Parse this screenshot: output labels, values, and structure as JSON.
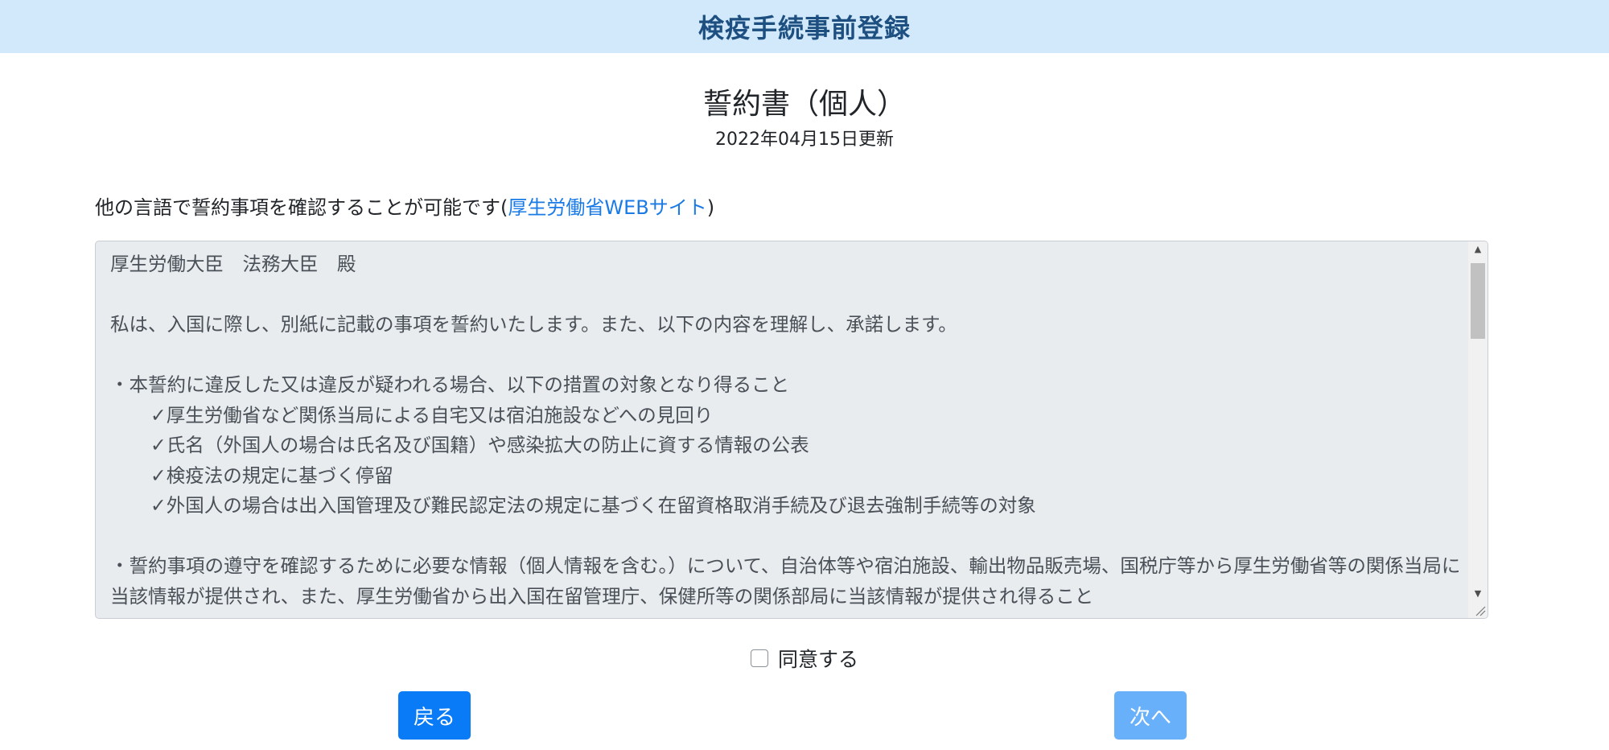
{
  "header": {
    "title": "検疫手続事前登録"
  },
  "document": {
    "title": "誓約書（個人）",
    "updated": "2022年04月15日更新"
  },
  "language_note": {
    "text": "他の言語で誓約事項を確認することが可能です(",
    "link": "厚生労働省WEBサイト",
    "suffix": ")"
  },
  "terms": {
    "addressee": "厚生労働大臣　法務大臣　殿",
    "intro": "私は、入国に際し、別紙に記載の事項を誓約いたします。また、以下の内容を理解し、承諾します。",
    "bullet1": "・本誓約に違反した又は違反が疑われる場合、以下の措置の対象となり得ること",
    "sub_items": [
      "✓厚生労働省など関係当局による自宅又は宿泊施設などへの見回り",
      "✓氏名（外国人の場合は氏名及び国籍）や感染拡大の防止に資する情報の公表",
      "✓検疫法の規定に基づく停留",
      "✓外国人の場合は出入国管理及び難民認定法の規定に基づく在留資格取消手続及び退去強制手続等の対象"
    ],
    "bullet2": "・誓約事項の遵守を確認するために必要な情報（個人情報を含む。）について、自治体等や宿泊施設、輸出物品販売場、国税庁等から厚生労働省等の関係当局に当該情報が提供され、また、厚生労働省から出入国在留管理庁、保健所等の関係部局に当該情報が提供され得ること"
  },
  "agree": {
    "label": "同意する",
    "checked": false
  },
  "buttons": {
    "back": "戻る",
    "next": "次へ"
  },
  "colors": {
    "header_bg": "#d2e8fb",
    "header_text": "#1d4f80",
    "link": "#1a7be6",
    "primary": "#0a7bf7",
    "primary_disabled": "#69b0fa"
  }
}
